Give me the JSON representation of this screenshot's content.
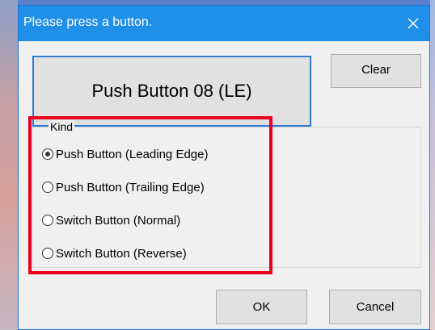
{
  "dialog": {
    "title": "Please press a button.",
    "close_icon": "close-icon",
    "pressed_display": "Push Button 08 (LE)",
    "clear_label": "Clear",
    "ok_label": "OK",
    "cancel_label": "Cancel"
  },
  "kind_group": {
    "legend": "Kind",
    "options": [
      {
        "label": "Push Button (Leading Edge)",
        "selected": true
      },
      {
        "label": "Push Button (Trailing Edge)",
        "selected": false
      },
      {
        "label": "Switch Button (Normal)",
        "selected": false
      },
      {
        "label": "Switch Button (Reverse)",
        "selected": false
      }
    ]
  },
  "colors": {
    "title_bar": "#1f8fe8",
    "highlight_frame": "#e8001c",
    "focus_border": "#2f7bd6"
  }
}
